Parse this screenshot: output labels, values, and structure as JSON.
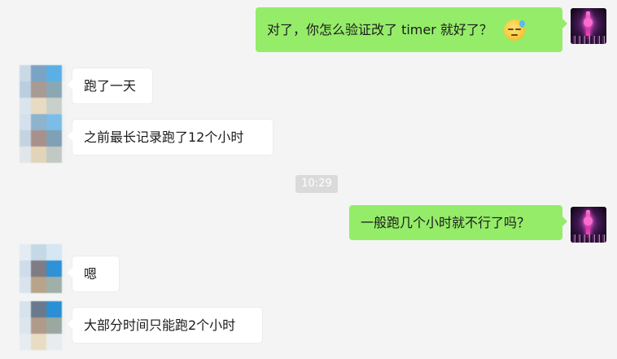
{
  "window": {
    "background": "#f4f4f4"
  },
  "colors": {
    "outgoing_bubble": "#95ec69",
    "incoming_bubble": "#ffffff",
    "time_badge": "#dadada"
  },
  "messages": [
    {
      "direction": "outgoing",
      "text": "对了，你怎么验证改了 timer 就好了？",
      "emoji": "sweat-smile-emoji"
    },
    {
      "direction": "incoming",
      "text": "跑了一天"
    },
    {
      "direction": "incoming",
      "text": "之前最长记录跑了12个小时"
    },
    {
      "type": "timestamp",
      "text": "10:29"
    },
    {
      "direction": "outgoing",
      "text": "一般跑几个小时就不行了吗？"
    },
    {
      "direction": "incoming",
      "text": "嗯"
    },
    {
      "direction": "incoming",
      "text": "大部分时间只能跑2个小时"
    }
  ],
  "avatars": {
    "self": "avatar-city-night",
    "other": "avatar-pixelated"
  }
}
